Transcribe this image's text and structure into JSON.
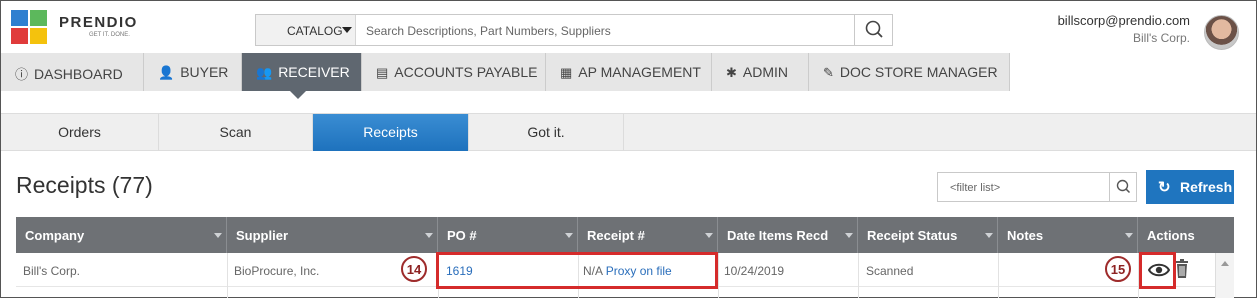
{
  "header": {
    "brand": "PRENDIO",
    "tagline": "GET IT. DONE.",
    "search": {
      "category": "CATALOG",
      "placeholder": "Search Descriptions, Part Numbers, Suppliers"
    },
    "user": {
      "email": "billscorp@prendio.com",
      "company": "Bill's Corp."
    },
    "logo_colors": [
      "#2f7fd0",
      "#5cb85c",
      "#e03b3b",
      "#f4c20d"
    ]
  },
  "topnav": [
    {
      "label": "DASHBOARD",
      "icon": "info-icon"
    },
    {
      "label": "BUYER",
      "icon": "buyer-icon"
    },
    {
      "label": "RECEIVER",
      "icon": "receiver-icon",
      "active": true
    },
    {
      "label": "ACCOUNTS PAYABLE",
      "icon": "document-icon"
    },
    {
      "label": "AP MANAGEMENT",
      "icon": "calculator-icon"
    },
    {
      "label": "ADMIN",
      "icon": "gear-icon"
    },
    {
      "label": "DOC STORE MANAGER",
      "icon": "edit-icon"
    }
  ],
  "subtabs": [
    {
      "label": "Orders"
    },
    {
      "label": "Scan"
    },
    {
      "label": "Receipts",
      "active": true
    },
    {
      "label": "Got it."
    }
  ],
  "page": {
    "title": "Receipts (77)",
    "filter_placeholder": "<filter list>",
    "refresh_label": "Refresh"
  },
  "table": {
    "columns": [
      "Company",
      "Supplier",
      "PO #",
      "Receipt #",
      "Date Items Recd",
      "Receipt Status",
      "Notes",
      "Actions"
    ],
    "rows": [
      {
        "company": "Bill's Corp.",
        "supplier": "BioProcure, Inc.",
        "po": "1619",
        "receipt_prefix": "N/A",
        "receipt_link": "Proxy on file",
        "date": "10/24/2019",
        "status": "Scanned",
        "notes": ""
      }
    ]
  },
  "callouts": {
    "step14": "14",
    "step15": "15"
  },
  "colors": {
    "accent": "#1f75bf",
    "nav_active": "#5f6770",
    "table_header": "#6e7175",
    "callout_red": "#d52b2b"
  }
}
